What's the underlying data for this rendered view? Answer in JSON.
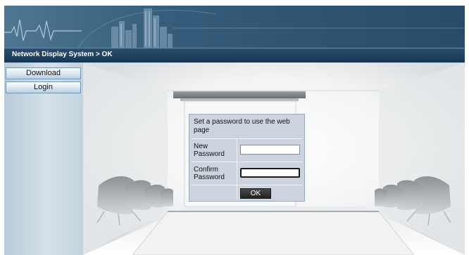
{
  "header": {
    "breadcrumb": "Network Display System > OK"
  },
  "sidebar": {
    "items": [
      {
        "label": "Download"
      },
      {
        "label": "Login"
      }
    ]
  },
  "dialog": {
    "title": "Set a password to use the web page",
    "new_password": {
      "label_line1": "New",
      "label_line2": "Password",
      "value": ""
    },
    "confirm_password": {
      "label_line1": "Confirm",
      "label_line2": "Password",
      "value": ""
    },
    "ok_label": "OK"
  },
  "colors": {
    "header_blue": "#2d5372",
    "breadcrumb_bar": "#173754",
    "sidebar": "#c9d8e3",
    "dialog_bg": "#ccd5df",
    "ok_button": "#2e2e2e"
  }
}
